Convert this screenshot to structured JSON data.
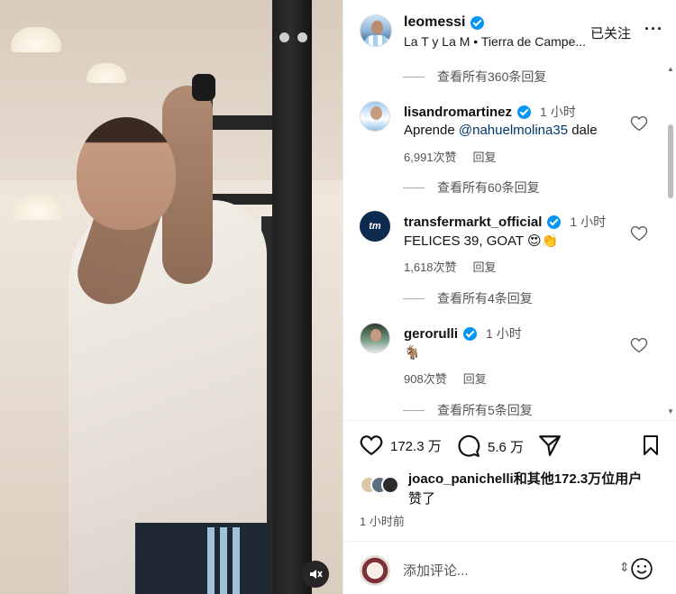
{
  "post": {
    "username": "leomessi",
    "location": "La T y La M • Tierra de Campe...",
    "follow_label": "已关注",
    "more_label": "···"
  },
  "comments": {
    "view_replies": [
      "查看所有360条回复",
      "查看所有60条回复",
      "查看所有4条回复",
      "查看所有5条回复"
    ],
    "items": [
      {
        "username": "lisandromartinez",
        "time": "1 小时",
        "text_before": "Aprende ",
        "mention": "@nahuelmolina35",
        "text_after": " dale",
        "likes": "6,991次赞",
        "reply_label": "回复"
      },
      {
        "username": "transfermarkt_official",
        "time": "1 小时",
        "text": "FELICES 39, GOAT 😍👏",
        "likes": "1,618次赞",
        "reply_label": "回复",
        "avatar_text": "tm"
      },
      {
        "username": "gerorulli",
        "time": "1 小时",
        "text": "🐐",
        "likes": "908次赞",
        "reply_label": "回复"
      }
    ]
  },
  "actions": {
    "likes_count": "172.3 万",
    "comments_count": "5.6 万"
  },
  "likers": {
    "name": "joaco_panichelli",
    "text": "和其他172.3万位用户",
    "text_line2": "赞了"
  },
  "posted_time": "1 小时前",
  "compose": {
    "placeholder": "添加评论..."
  },
  "colors": {
    "verified": "#0095f6",
    "mention": "#00376b",
    "text": "#111111",
    "muted": "#555555"
  },
  "icons": [
    "verified-badge-icon",
    "heart-icon",
    "comment-icon",
    "share-icon",
    "bookmark-icon",
    "emoji-icon",
    "mute-icon",
    "more-icon"
  ]
}
